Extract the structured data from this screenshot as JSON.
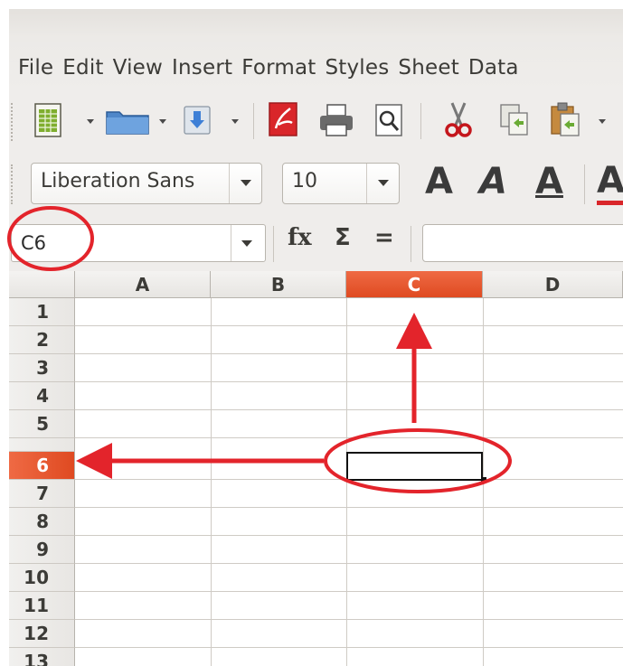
{
  "menubar": {
    "items": [
      "File",
      "Edit",
      "View",
      "Insert",
      "Format",
      "Styles",
      "Sheet",
      "Data"
    ]
  },
  "toolbar": {
    "icons": [
      "new-spreadsheet-icon",
      "open-folder-icon",
      "save-icon",
      "export-pdf-icon",
      "print-icon",
      "print-preview-icon",
      "cut-icon",
      "copy-icon",
      "paste-icon"
    ]
  },
  "format": {
    "font_name": "Liberation Sans",
    "font_size": "10",
    "bold_glyph": "A",
    "italic_glyph": "A",
    "underline_glyph": "A",
    "color_glyph": "A"
  },
  "formula_bar": {
    "name_box_value": "C6",
    "fx_label": "fx",
    "sum_label": "Σ",
    "equals_label": "=",
    "formula_value": ""
  },
  "grid": {
    "columns": [
      "A",
      "B",
      "C",
      "D"
    ],
    "rows": [
      "1",
      "2",
      "3",
      "4",
      "5",
      "6",
      "7",
      "8",
      "9",
      "10",
      "11",
      "12",
      "13"
    ],
    "selected_column": "C",
    "selected_row": "6",
    "active_cell": "C6"
  },
  "colors": {
    "selection": "#e2512a",
    "annotation": "#e3242b"
  }
}
